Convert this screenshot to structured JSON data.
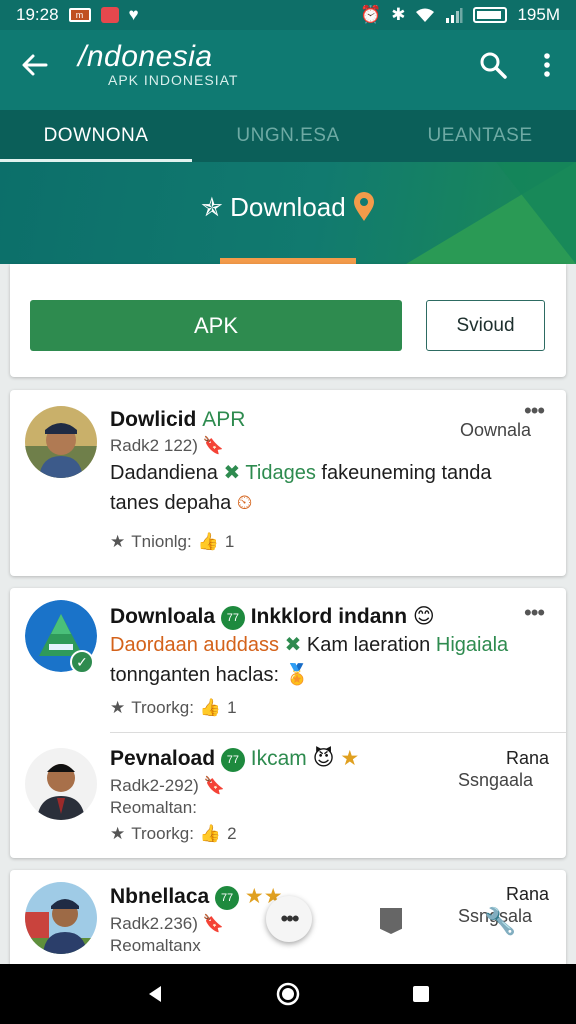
{
  "status_bar": {
    "time": "19:28",
    "badge_1": "m",
    "battery_text": "195M"
  },
  "app_bar": {
    "title": "/ndonesia",
    "subtitle": "APK INDONESIAT"
  },
  "tabs": [
    {
      "label": "DOWNONA",
      "active": true
    },
    {
      "label": "UNGN.ESA",
      "active": false
    },
    {
      "label": "UEANTASE",
      "active": false
    }
  ],
  "hero": {
    "label": "Download"
  },
  "actions": {
    "primary_label": "APK",
    "secondary_label": "Svioud"
  },
  "items": [
    {
      "title": "Dowlicid",
      "title_accent": "APR",
      "meta": "Radk2 122)",
      "desc_1": "Dadandiena",
      "desc_accent": "Tidages",
      "desc_2": "fakeuneming tanda",
      "desc_3": "tanes depaha",
      "stat_label": "Tnionlg:",
      "stat_value": "1",
      "side": "Oownala"
    },
    {
      "title": "Downloala",
      "badge": "77",
      "title_2": "Inkklord indann",
      "desc_1": "Daordaan auddass",
      "desc_2": "Kam laeration",
      "desc_accent": "Higaiala",
      "desc_3": "tonnganten haclas:",
      "stat_label": "Troorkg:",
      "stat_value": "1"
    },
    {
      "title": "Pevnaload",
      "badge": "77",
      "title_accent": "Ikcam",
      "meta": "Radk2-292)",
      "meta_2": "Reomaltan:",
      "stat_label": "Troorkg:",
      "stat_value": "2",
      "side_top": "Rana",
      "side": "Ssngaala"
    },
    {
      "title": "Nbnellaca",
      "badge": "77",
      "meta": "Radk2.236)",
      "meta_2": "Reomaltanx",
      "side_top": "Rana",
      "side": "Ssngsala"
    }
  ],
  "icons": {
    "back": "arrow-left-icon",
    "search": "search-icon",
    "more": "more-vert-icon",
    "hero": "sparkle-icon",
    "location": "location-pin-icon",
    "star": "star-icon",
    "thumb": "thumb-up-icon",
    "verified": "check-circle-icon"
  },
  "colors": {
    "primary": "#0f7a72",
    "accent_green": "#2e8b4f",
    "hero_underline": "#f39b4a"
  }
}
